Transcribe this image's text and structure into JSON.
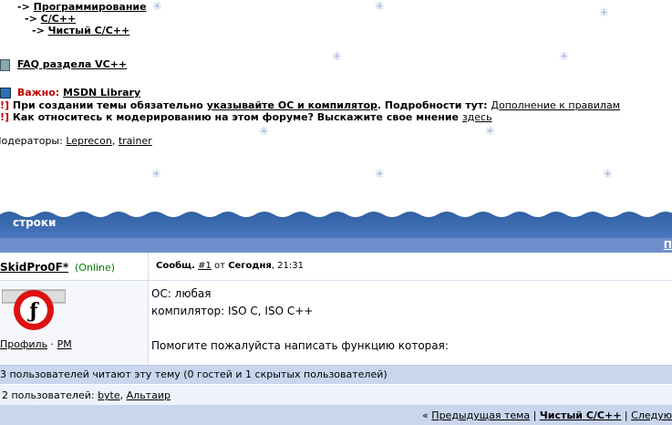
{
  "breadcrumb": {
    "items": [
      "Программирование",
      "C/C++",
      "Чистый C/C++"
    ],
    "arrow": "->"
  },
  "faq": {
    "label": "FAQ раздела VC++"
  },
  "notices": {
    "important_prefix": "Важно:",
    "important_link": "MSDN Library",
    "line2_prefix": "!]",
    "line2_text": "При создании темы обязательно ",
    "line2_link": "указывайте ОС и компилятор",
    "line2_mid": ". Подробности тут: ",
    "line2_link2": "Дополнение к правилам",
    "line3_prefix": "!]",
    "line3_text": "Как относитесь к модерированию на этом форуме? Выскажите свое мнение ",
    "line3_link": "здесь"
  },
  "moderators": {
    "label": "Модераторы:",
    "users": [
      "Leprecon",
      "trainer"
    ]
  },
  "thread": {
    "title": "строки",
    "bluebar_right": "П"
  },
  "post": {
    "author": "SkidPro0F*",
    "status": "(Online)",
    "meta_label": "Сообщ.",
    "post_num": "#1",
    "meta_from": "от",
    "date": "Сегодня",
    "time": ", 21:31",
    "profile_link": "Профиль",
    "pm_link": "PM",
    "body_lines": [
      "ОС: любая",
      "компилятор: ISO C, ISO C++",
      "",
      "Помогите пожалуйста написать функцию которая:"
    ]
  },
  "footer": {
    "readers": "3 пользователей читают эту тему (0 гостей и 1 скрытых пользователей)",
    "users_label": "2 пользователей:",
    "users": [
      "byte",
      "Альтаир"
    ],
    "prev": "Предыдущая тема",
    "current": "Чистый C/C++",
    "next": "Следую",
    "prev_prefix": "«"
  },
  "colors": {
    "header_blue": "#2e5ea3",
    "accent_red": "#c00000",
    "status_green": "#008000"
  }
}
